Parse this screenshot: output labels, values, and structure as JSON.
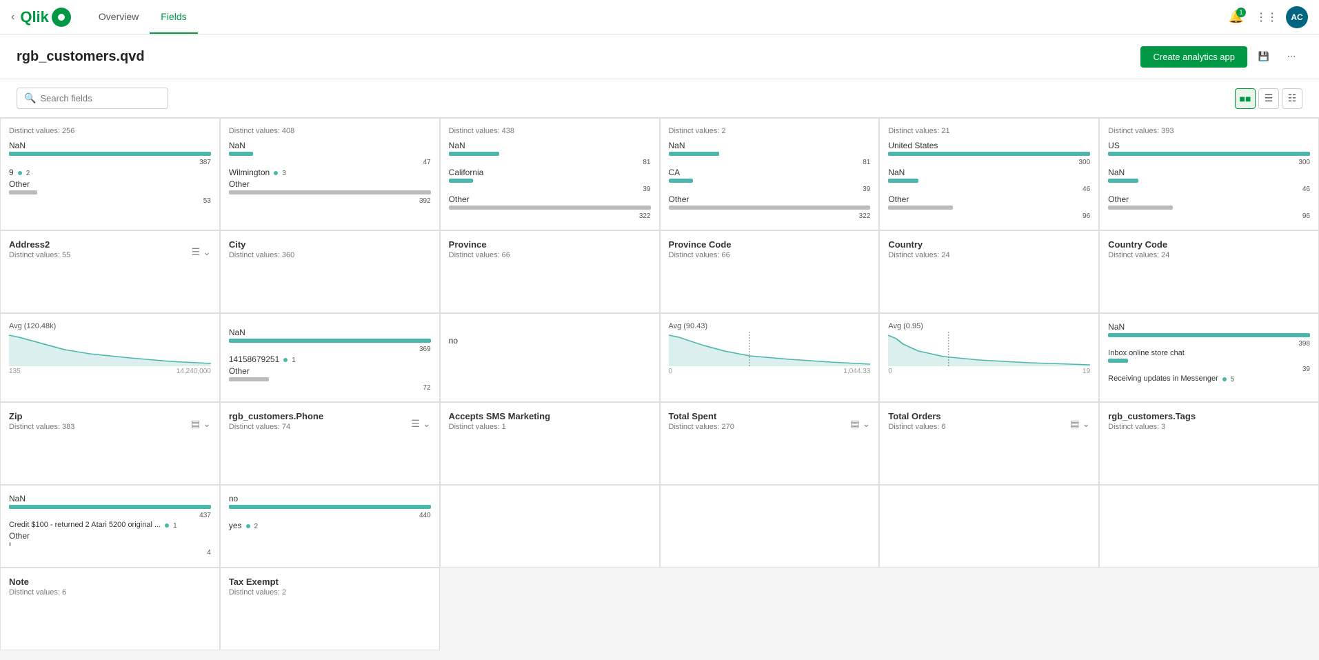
{
  "header": {
    "back_icon": "←",
    "logo_text": "Qlik",
    "nav": [
      {
        "label": "Overview",
        "active": false
      },
      {
        "label": "Fields",
        "active": true
      }
    ],
    "notif_count": "1",
    "avatar_text": "AC"
  },
  "page": {
    "title": "rgb_customers.qvd",
    "create_btn": "Create analytics app"
  },
  "toolbar": {
    "search_placeholder": "Search fields"
  },
  "fields": [
    {
      "name": "",
      "distinct": "Distinct values: 256",
      "values": [
        {
          "label": "NaN",
          "bar_width": "100%",
          "bar_class": "bar-teal",
          "count": "387"
        },
        {
          "label": "9",
          "dot": true,
          "dot_val": "2",
          "bar_width": "0%",
          "count": ""
        },
        {
          "label": "Other",
          "bar_width": "14%",
          "bar_class": "bar-gray",
          "count": "53"
        }
      ]
    },
    {
      "name": "",
      "distinct": "Distinct values: 408",
      "values": [
        {
          "label": "NaN",
          "bar_width": "12%",
          "bar_class": "bar-teal",
          "count": "47"
        },
        {
          "label": "Wilmington",
          "dot": true,
          "dot_val": "3",
          "bar_width": "0%",
          "count": ""
        },
        {
          "label": "Other",
          "bar_width": "100%",
          "bar_class": "bar-gray",
          "count": "392"
        }
      ]
    },
    {
      "name": "",
      "distinct": "Distinct values: 438",
      "values": [
        {
          "label": "NaN",
          "bar_width": "25%",
          "bar_class": "bar-teal",
          "count": "81"
        },
        {
          "label": "California",
          "bar_width": "12%",
          "bar_class": "bar-teal",
          "count": "39"
        },
        {
          "label": "Other",
          "bar_width": "100%",
          "bar_class": "bar-gray",
          "count": "322"
        }
      ]
    },
    {
      "name": "",
      "distinct": "Distinct values: 2",
      "values": [
        {
          "label": "NaN",
          "bar_width": "25%",
          "bar_class": "bar-teal",
          "count": "81"
        },
        {
          "label": "CA",
          "bar_width": "12%",
          "bar_class": "bar-teal",
          "count": "39"
        },
        {
          "label": "Other",
          "bar_width": "100%",
          "bar_class": "bar-gray",
          "count": "322"
        }
      ]
    },
    {
      "name": "",
      "distinct": "Distinct values: 21",
      "values": [
        {
          "label": "United States",
          "bar_width": "100%",
          "bar_class": "bar-teal",
          "count": "300"
        },
        {
          "label": "NaN",
          "bar_width": "15%",
          "bar_class": "bar-teal",
          "count": "46"
        },
        {
          "label": "Other",
          "bar_width": "32%",
          "bar_class": "bar-gray",
          "count": "96"
        }
      ]
    },
    {
      "name": "",
      "distinct": "Distinct values: 393",
      "values": [
        {
          "label": "US",
          "bar_width": "100%",
          "bar_class": "bar-teal",
          "count": "300"
        },
        {
          "label": "NaN",
          "bar_width": "15%",
          "bar_class": "bar-teal",
          "count": "46"
        },
        {
          "label": "Other",
          "bar_width": "32%",
          "bar_class": "bar-gray",
          "count": "96"
        }
      ]
    },
    {
      "name": "Address2",
      "distinct": "Distinct values: 55",
      "has_actions": true
    },
    {
      "name": "City",
      "distinct": "Distinct values: 360",
      "has_actions": false
    },
    {
      "name": "Province",
      "distinct": "Distinct values: 66",
      "has_actions": false
    },
    {
      "name": "Province Code",
      "distinct": "Distinct values: 66",
      "has_actions": false
    },
    {
      "name": "Country",
      "distinct": "Distinct values: 24",
      "has_actions": false
    },
    {
      "name": "Country Code",
      "distinct": "Distinct values: 24",
      "has_actions": false
    },
    {
      "name": "",
      "distinct": "",
      "is_chart": true,
      "avg_label": "Avg (120.48k)",
      "chart_type": "decay",
      "min_val": "135",
      "max_val": "14,240,000"
    },
    {
      "name": "",
      "distinct": "",
      "values_special": [
        {
          "label": "NaN",
          "bar_width": "100%",
          "bar_class": "bar-teal",
          "count": "369"
        },
        {
          "label": "14158679251",
          "dot": true,
          "dot_val": "1",
          "count": ""
        },
        {
          "label": "Other",
          "bar_width": "20%",
          "bar_class": "bar-gray",
          "count": "72"
        }
      ]
    },
    {
      "name": "",
      "distinct": "",
      "values_simple": [
        {
          "label": "no",
          "count": ""
        }
      ]
    },
    {
      "name": "",
      "distinct": "",
      "is_chart": true,
      "avg_label": "Avg (90.43)",
      "chart_type": "decay",
      "min_val": "0",
      "max_val": "1,044.33"
    },
    {
      "name": "",
      "distinct": "",
      "is_chart": true,
      "avg_label": "Avg (0.95)",
      "chart_type": "decay",
      "min_val": "0",
      "max_val": "19"
    },
    {
      "name": "",
      "distinct": "",
      "values_tags": [
        {
          "label": "NaN",
          "bar_width": "100%",
          "bar_class": "bar-teal",
          "count": "398"
        },
        {
          "label": "Inbox online store chat",
          "bar_width": "10%",
          "bar_class": "bar-teal",
          "count": "39"
        },
        {
          "label": "Receiving updates in Messenger",
          "dot": true,
          "dot_val": "5",
          "count": ""
        }
      ]
    },
    {
      "name": "Zip",
      "distinct": "Distinct values: 383",
      "has_actions": true,
      "has_chart_icon": true
    },
    {
      "name": "rgb_customers.Phone",
      "distinct": "Distinct values: 74",
      "has_actions": true
    },
    {
      "name": "Accepts SMS Marketing",
      "distinct": "Distinct values: 1",
      "has_actions": false
    },
    {
      "name": "Total Spent",
      "distinct": "Distinct values: 270",
      "has_actions": true,
      "has_chart_icon": true
    },
    {
      "name": "Total Orders",
      "distinct": "Distinct values: 6",
      "has_actions": true,
      "has_chart_icon": true
    },
    {
      "name": "rgb_customers.Tags",
      "distinct": "Distinct values: 3",
      "has_actions": false
    },
    {
      "name": "",
      "distinct": "",
      "is_zip_values": true,
      "values": [
        {
          "label": "NaN",
          "bar_width": "100%",
          "bar_class": "bar-teal",
          "count": "437"
        },
        {
          "label": "Credit $100 - returned 2 Atari 5200 original ...",
          "dot": true,
          "dot_val": "1",
          "count": ""
        },
        {
          "label": "Other",
          "bar_width": "1%",
          "bar_class": "bar-gray",
          "count": "4"
        }
      ]
    },
    {
      "name": "",
      "distinct": "",
      "is_tax_values": true,
      "values": [
        {
          "label": "no",
          "bar_width": "100%",
          "bar_class": "bar-teal",
          "count": "440"
        },
        {
          "label": "yes",
          "dot": true,
          "dot_val": "2",
          "count": ""
        }
      ]
    },
    {
      "name": "",
      "distinct": "",
      "is_empty": true
    },
    {
      "name": "",
      "distinct": "",
      "is_empty": true
    },
    {
      "name": "",
      "distinct": "",
      "is_empty": true
    },
    {
      "name": "",
      "distinct": "",
      "is_empty": true
    },
    {
      "name": "Note",
      "distinct": "Distinct values: 6",
      "has_actions": false
    },
    {
      "name": "Tax Exempt",
      "distinct": "Distinct values: 2",
      "has_actions": false
    }
  ]
}
